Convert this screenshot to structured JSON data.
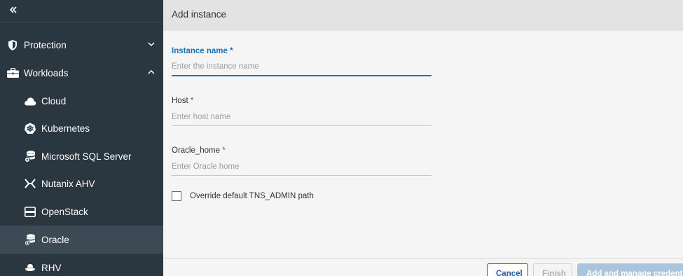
{
  "sidebar": {
    "collapse_icon": "double-chevron-left-icon",
    "items": [
      {
        "label": "Protection",
        "icon": "shield-icon",
        "expanded": false
      },
      {
        "label": "Workloads",
        "icon": "briefcase-icon",
        "expanded": true
      },
      {
        "label": "Cloud",
        "icon": "cloud-icon"
      },
      {
        "label": "Kubernetes",
        "icon": "kubernetes-icon"
      },
      {
        "label": "Microsoft SQL Server",
        "icon": "database-icon"
      },
      {
        "label": "Nutanix AHV",
        "icon": "nutanix-icon"
      },
      {
        "label": "OpenStack",
        "icon": "openstack-icon"
      },
      {
        "label": "Oracle",
        "icon": "database-icon",
        "active": true
      },
      {
        "label": "RHV",
        "icon": "rhv-icon"
      }
    ]
  },
  "dialog": {
    "title": "Add instance",
    "fields": {
      "instance_name": {
        "label": "Instance name",
        "placeholder": "Enter the instance name",
        "value": ""
      },
      "host": {
        "label": "Host",
        "placeholder": "Enter host name",
        "value": ""
      },
      "oracle_home": {
        "label": "Oracle_home",
        "placeholder": "Enter Oracle home",
        "value": ""
      }
    },
    "required_marker": "*",
    "override_checkbox": {
      "label": "Override default TNS_ADMIN path",
      "checked": false
    },
    "buttons": {
      "cancel": "Cancel",
      "finish": "Finish",
      "add_manage": "Add and manage credentials"
    }
  },
  "colors": {
    "sidebar_bg": "#2a3640",
    "active_item_bg": "#3d4a55",
    "accent": "#1a73b8",
    "header_bg": "#e3e3e3"
  }
}
